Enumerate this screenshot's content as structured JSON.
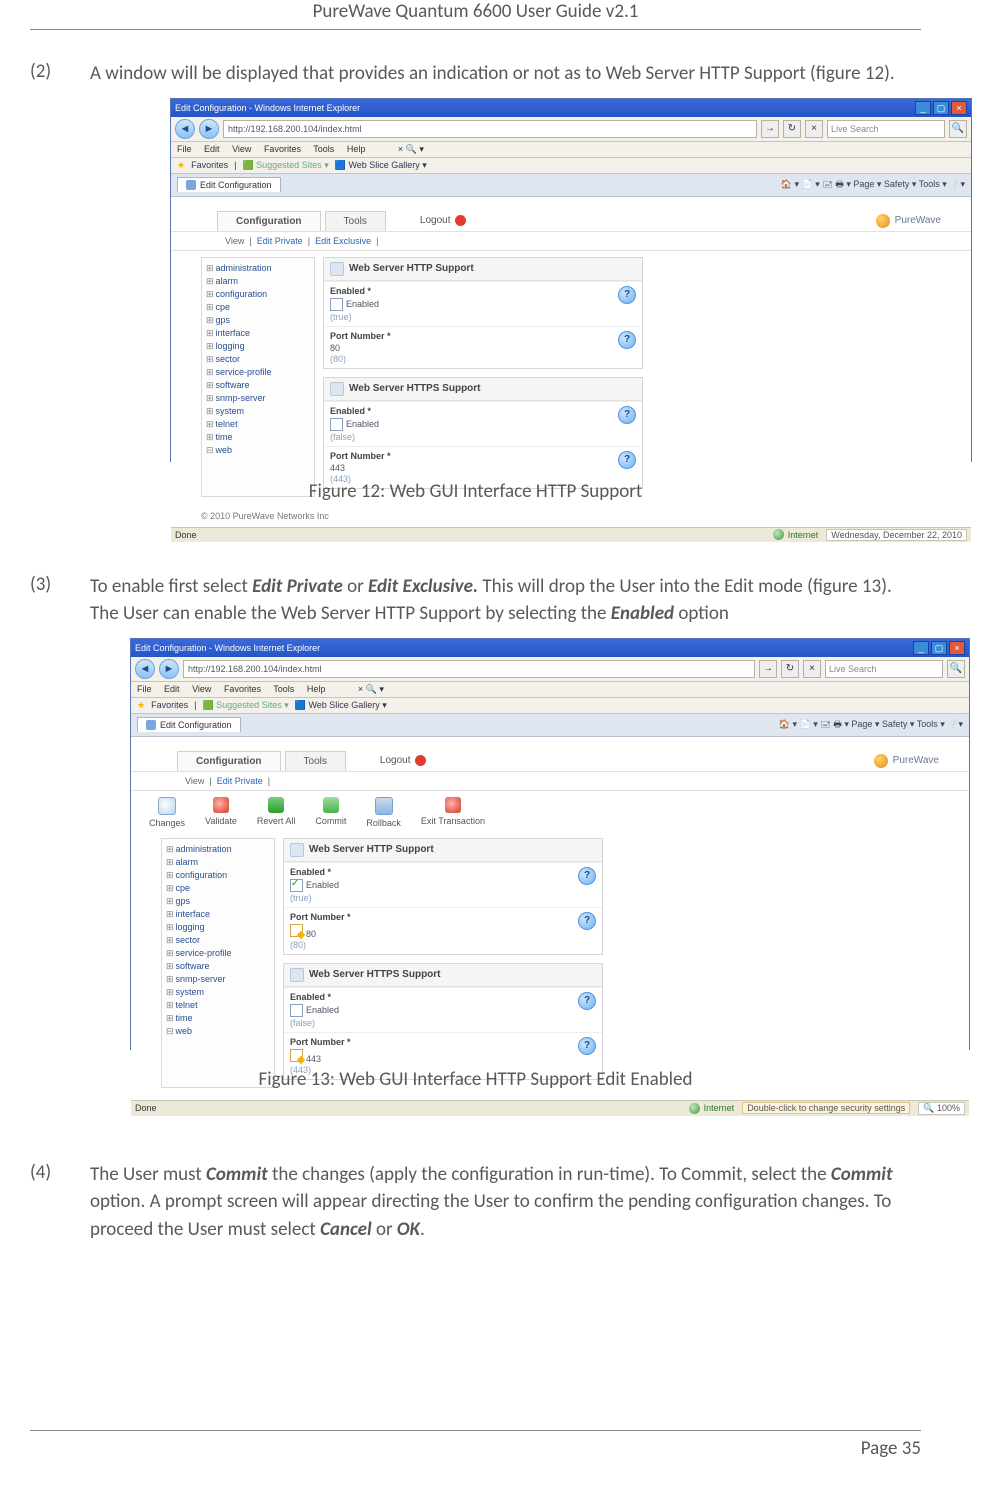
{
  "header": "PureWave Quantum 6600 User Guide v2.1",
  "steps": {
    "s2": {
      "num": "(2)",
      "text_a": "A window will be displayed that provides an indication or not as to Web Server HTTP Support (figure 12)."
    },
    "s3": {
      "num": "(3)",
      "pre": "To enable first select ",
      "b1": "Edit Private",
      "mid1": " or ",
      "b2": "Edit Exclusive.",
      "mid2": " This will drop the User into the Edit mode (figure 13). The User can enable the Web Server HTTP Support by selecting the ",
      "b3": "Enabled",
      "post": " option"
    },
    "s4": {
      "num": "(4)",
      "pre": "The User must ",
      "b1": "Commit",
      "mid1": " the changes (apply the configuration in run-time). To Commit, select the ",
      "b2": "Commit",
      "mid2": " option. A prompt screen will appear directing the User to confirm the pending configuration changes. To proceed the User must select ",
      "b3": "Cancel",
      "mid3": " or ",
      "b4": "OK",
      "post": "."
    }
  },
  "captions": {
    "f12": "Figure 12: Web GUI Interface HTTP Support",
    "f13": "Figure 13: Web GUI Interface HTTP Support Edit Enabled"
  },
  "footer": {
    "page": "Page 35"
  },
  "ie": {
    "title": "Edit Configuration - Windows Internet Explorer",
    "url": "http://192.168.200.104/index.html",
    "search_ph": "Live Search",
    "menu": {
      "file": "File",
      "edit": "Edit",
      "view": "View",
      "fav": "Favorites",
      "tools": "Tools",
      "help": "Help"
    },
    "favbar": {
      "label": "Favorites",
      "s1": "Suggested Sites ▾",
      "s2": "Web Slice Gallery ▾"
    },
    "tab": "Edit Configuration",
    "tools": "🏠 ▾  📄 ▾  🖃 🖶 ▾  Page ▾  Safety ▾  Tools ▾  ❔▾",
    "status_done": "Done",
    "status_inet": "Internet",
    "status_date": "Wednesday, December 22, 2010",
    "status_sec": "Double-click to change security settings",
    "status_zoom": "🔍 100%"
  },
  "app": {
    "tabs": {
      "conf": "Configuration",
      "tools": "Tools"
    },
    "logout": "Logout",
    "brand": "PureWave",
    "sub_view": "View",
    "sub_ep": "Edit Private",
    "sub_ee": "Edit Exclusive",
    "tree": [
      "administration",
      "alarm",
      "configuration",
      "cpe",
      "gps",
      "interface",
      "logging",
      "sector",
      "service-profile",
      "software",
      "snmp-server",
      "system",
      "telnet",
      "time",
      "web"
    ],
    "panels": {
      "http": {
        "title": "Web Server HTTP Support",
        "en_lab": "Enabled *",
        "en_val": "Enabled",
        "en_def": "(true)",
        "pn_lab": "Port Number *",
        "pn_val": "80",
        "pn_def": "(80)"
      },
      "https": {
        "title": "Web Server HTTPS Support",
        "en_lab": "Enabled *",
        "en_val": "Enabled",
        "en_def": "(false)",
        "pn_lab": "Port Number *",
        "pn_val": "443",
        "pn_def": "(443)"
      }
    },
    "toolbar": {
      "changes": "Changes",
      "validate": "Validate",
      "revert": "Revert All",
      "commit": "Commit",
      "rollback": "Rollback",
      "exit": "Exit Transaction"
    },
    "copyright": "© 2010 PureWave Networks Inc"
  }
}
